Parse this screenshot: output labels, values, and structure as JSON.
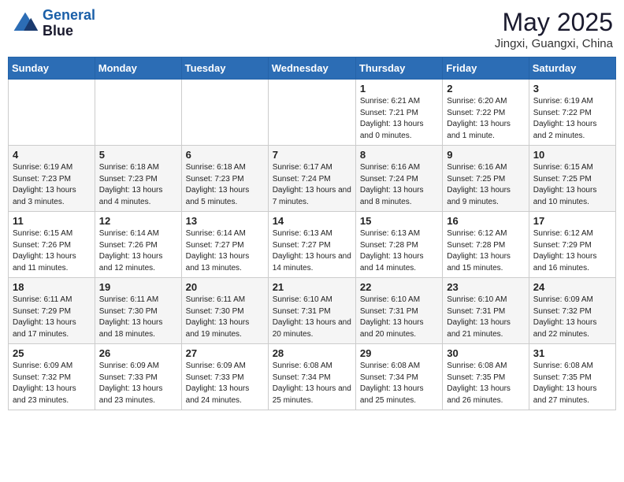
{
  "header": {
    "logo_line1": "General",
    "logo_line2": "Blue",
    "month": "May 2025",
    "location": "Jingxi, Guangxi, China"
  },
  "days_of_week": [
    "Sunday",
    "Monday",
    "Tuesday",
    "Wednesday",
    "Thursday",
    "Friday",
    "Saturday"
  ],
  "weeks": [
    [
      {
        "day": "",
        "info": ""
      },
      {
        "day": "",
        "info": ""
      },
      {
        "day": "",
        "info": ""
      },
      {
        "day": "",
        "info": ""
      },
      {
        "day": "1",
        "info": "Sunrise: 6:21 AM\nSunset: 7:21 PM\nDaylight: 13 hours and 0 minutes."
      },
      {
        "day": "2",
        "info": "Sunrise: 6:20 AM\nSunset: 7:22 PM\nDaylight: 13 hours and 1 minute."
      },
      {
        "day": "3",
        "info": "Sunrise: 6:19 AM\nSunset: 7:22 PM\nDaylight: 13 hours and 2 minutes."
      }
    ],
    [
      {
        "day": "4",
        "info": "Sunrise: 6:19 AM\nSunset: 7:23 PM\nDaylight: 13 hours and 3 minutes."
      },
      {
        "day": "5",
        "info": "Sunrise: 6:18 AM\nSunset: 7:23 PM\nDaylight: 13 hours and 4 minutes."
      },
      {
        "day": "6",
        "info": "Sunrise: 6:18 AM\nSunset: 7:23 PM\nDaylight: 13 hours and 5 minutes."
      },
      {
        "day": "7",
        "info": "Sunrise: 6:17 AM\nSunset: 7:24 PM\nDaylight: 13 hours and 7 minutes."
      },
      {
        "day": "8",
        "info": "Sunrise: 6:16 AM\nSunset: 7:24 PM\nDaylight: 13 hours and 8 minutes."
      },
      {
        "day": "9",
        "info": "Sunrise: 6:16 AM\nSunset: 7:25 PM\nDaylight: 13 hours and 9 minutes."
      },
      {
        "day": "10",
        "info": "Sunrise: 6:15 AM\nSunset: 7:25 PM\nDaylight: 13 hours and 10 minutes."
      }
    ],
    [
      {
        "day": "11",
        "info": "Sunrise: 6:15 AM\nSunset: 7:26 PM\nDaylight: 13 hours and 11 minutes."
      },
      {
        "day": "12",
        "info": "Sunrise: 6:14 AM\nSunset: 7:26 PM\nDaylight: 13 hours and 12 minutes."
      },
      {
        "day": "13",
        "info": "Sunrise: 6:14 AM\nSunset: 7:27 PM\nDaylight: 13 hours and 13 minutes."
      },
      {
        "day": "14",
        "info": "Sunrise: 6:13 AM\nSunset: 7:27 PM\nDaylight: 13 hours and 14 minutes."
      },
      {
        "day": "15",
        "info": "Sunrise: 6:13 AM\nSunset: 7:28 PM\nDaylight: 13 hours and 14 minutes."
      },
      {
        "day": "16",
        "info": "Sunrise: 6:12 AM\nSunset: 7:28 PM\nDaylight: 13 hours and 15 minutes."
      },
      {
        "day": "17",
        "info": "Sunrise: 6:12 AM\nSunset: 7:29 PM\nDaylight: 13 hours and 16 minutes."
      }
    ],
    [
      {
        "day": "18",
        "info": "Sunrise: 6:11 AM\nSunset: 7:29 PM\nDaylight: 13 hours and 17 minutes."
      },
      {
        "day": "19",
        "info": "Sunrise: 6:11 AM\nSunset: 7:30 PM\nDaylight: 13 hours and 18 minutes."
      },
      {
        "day": "20",
        "info": "Sunrise: 6:11 AM\nSunset: 7:30 PM\nDaylight: 13 hours and 19 minutes."
      },
      {
        "day": "21",
        "info": "Sunrise: 6:10 AM\nSunset: 7:31 PM\nDaylight: 13 hours and 20 minutes."
      },
      {
        "day": "22",
        "info": "Sunrise: 6:10 AM\nSunset: 7:31 PM\nDaylight: 13 hours and 20 minutes."
      },
      {
        "day": "23",
        "info": "Sunrise: 6:10 AM\nSunset: 7:31 PM\nDaylight: 13 hours and 21 minutes."
      },
      {
        "day": "24",
        "info": "Sunrise: 6:09 AM\nSunset: 7:32 PM\nDaylight: 13 hours and 22 minutes."
      }
    ],
    [
      {
        "day": "25",
        "info": "Sunrise: 6:09 AM\nSunset: 7:32 PM\nDaylight: 13 hours and 23 minutes."
      },
      {
        "day": "26",
        "info": "Sunrise: 6:09 AM\nSunset: 7:33 PM\nDaylight: 13 hours and 23 minutes."
      },
      {
        "day": "27",
        "info": "Sunrise: 6:09 AM\nSunset: 7:33 PM\nDaylight: 13 hours and 24 minutes."
      },
      {
        "day": "28",
        "info": "Sunrise: 6:08 AM\nSunset: 7:34 PM\nDaylight: 13 hours and 25 minutes."
      },
      {
        "day": "29",
        "info": "Sunrise: 6:08 AM\nSunset: 7:34 PM\nDaylight: 13 hours and 25 minutes."
      },
      {
        "day": "30",
        "info": "Sunrise: 6:08 AM\nSunset: 7:35 PM\nDaylight: 13 hours and 26 minutes."
      },
      {
        "day": "31",
        "info": "Sunrise: 6:08 AM\nSunset: 7:35 PM\nDaylight: 13 hours and 27 minutes."
      }
    ]
  ]
}
